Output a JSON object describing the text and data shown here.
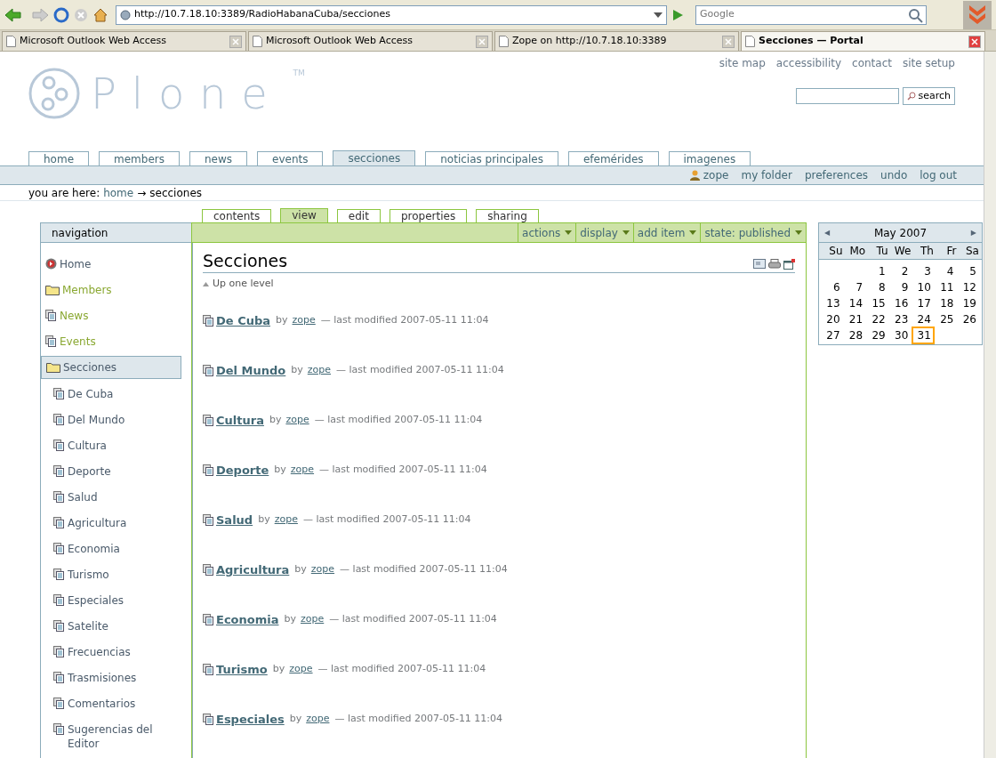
{
  "browser": {
    "url": "http://10.7.18.10:3389/RadioHabanaCuba/secciones",
    "search_placeholder": "Google",
    "tabs": [
      {
        "label": "Microsoft Outlook Web Access",
        "selected": false
      },
      {
        "label": "Microsoft Outlook Web Access",
        "selected": false
      },
      {
        "label": "Zope on http://10.7.18.10:3389",
        "selected": false
      },
      {
        "label": "Secciones — Portal",
        "selected": true
      }
    ]
  },
  "logo": {
    "text": "Plone",
    "mark": "TM"
  },
  "site_actions": [
    "site map",
    "accessibility",
    "contact",
    "site setup"
  ],
  "search": {
    "button": "search"
  },
  "portal_tabs": [
    {
      "label": "home",
      "selected": false
    },
    {
      "label": "members",
      "selected": false
    },
    {
      "label": "news",
      "selected": false
    },
    {
      "label": "events",
      "selected": false
    },
    {
      "label": "secciones",
      "selected": true
    },
    {
      "label": "noticias principales",
      "selected": false
    },
    {
      "label": "efemérides",
      "selected": false
    },
    {
      "label": "imagenes",
      "selected": false
    }
  ],
  "personal_bar": {
    "user": "zope",
    "links": [
      "my folder",
      "preferences",
      "undo",
      "log out"
    ]
  },
  "breadcrumbs": {
    "label": "you are here:",
    "items": [
      {
        "text": "home",
        "link": true
      },
      {
        "text": "secciones",
        "link": false
      }
    ],
    "separator": "→"
  },
  "navigation": {
    "title": "navigation",
    "items": [
      {
        "label": "Home",
        "kind": "home",
        "color": "#4a5a6a",
        "selected": false
      },
      {
        "label": "Members",
        "kind": "folder",
        "color": "#8aa832",
        "selected": false
      },
      {
        "label": "News",
        "kind": "document",
        "color": "#8aa832",
        "selected": false
      },
      {
        "label": "Events",
        "kind": "document",
        "color": "#8aa832",
        "selected": false
      },
      {
        "label": "Secciones",
        "kind": "folder",
        "color": "#4a5a6a",
        "selected": true,
        "children": [
          {
            "label": "De Cuba",
            "kind": "document",
            "color": "#4a5a6a",
            "selected": false
          },
          {
            "label": "Del Mundo",
            "kind": "document",
            "color": "#4a5a6a",
            "selected": false
          },
          {
            "label": "Cultura",
            "kind": "document",
            "color": "#4a5a6a",
            "selected": false
          },
          {
            "label": "Deporte",
            "kind": "document",
            "color": "#4a5a6a",
            "selected": false
          },
          {
            "label": "Salud",
            "kind": "document",
            "color": "#4a5a6a",
            "selected": false
          },
          {
            "label": "Agricultura",
            "kind": "document",
            "color": "#4a5a6a",
            "selected": false
          },
          {
            "label": "Economia",
            "kind": "document",
            "color": "#4a5a6a",
            "selected": false
          },
          {
            "label": "Turismo",
            "kind": "document",
            "color": "#4a5a6a",
            "selected": false
          },
          {
            "label": "Especiales",
            "kind": "document",
            "color": "#4a5a6a",
            "selected": false
          },
          {
            "label": "Satelite",
            "kind": "document",
            "color": "#4a5a6a",
            "selected": false
          },
          {
            "label": "Frecuencias",
            "kind": "document",
            "color": "#4a5a6a",
            "selected": false
          },
          {
            "label": "Trasmisiones",
            "kind": "document",
            "color": "#4a5a6a",
            "selected": false
          },
          {
            "label": "Comentarios",
            "kind": "document",
            "color": "#4a5a6a",
            "selected": false
          },
          {
            "label": "Sugerencias del Editor",
            "kind": "document",
            "color": "#4a5a6a",
            "selected": false
          }
        ]
      }
    ]
  },
  "content_tabs": [
    {
      "label": "contents",
      "selected": false
    },
    {
      "label": "view",
      "selected": true
    },
    {
      "label": "edit",
      "selected": false
    },
    {
      "label": "properties",
      "selected": false
    },
    {
      "label": "sharing",
      "selected": false
    }
  ],
  "content_menus": [
    "actions",
    "display",
    "add item",
    "state: published"
  ],
  "page": {
    "title": "Secciones",
    "up_link": "Up one level",
    "items": [
      {
        "title": "De Cuba",
        "by": "by",
        "author": "zope",
        "modified": "— last modified 2007-05-11 11:04"
      },
      {
        "title": "Del Mundo",
        "by": "by",
        "author": "zope",
        "modified": "— last modified 2007-05-11 11:04"
      },
      {
        "title": "Cultura",
        "by": "by",
        "author": "zope",
        "modified": "— last modified 2007-05-11 11:04"
      },
      {
        "title": "Deporte",
        "by": "by",
        "author": "zope",
        "modified": "— last modified 2007-05-11 11:04"
      },
      {
        "title": "Salud",
        "by": "by",
        "author": "zope",
        "modified": "— last modified 2007-05-11 11:04"
      },
      {
        "title": "Agricultura",
        "by": "by",
        "author": "zope",
        "modified": "— last modified 2007-05-11 11:04"
      },
      {
        "title": "Economia",
        "by": "by",
        "author": "zope",
        "modified": "— last modified 2007-05-11 11:04"
      },
      {
        "title": "Turismo",
        "by": "by",
        "author": "zope",
        "modified": "— last modified 2007-05-11 11:04"
      },
      {
        "title": "Especiales",
        "by": "by",
        "author": "zope",
        "modified": "— last modified 2007-05-11 11:04"
      }
    ]
  },
  "calendar": {
    "month": "May 2007",
    "prev": "◀",
    "next": "▶",
    "weekdays": [
      "Su",
      "Mo",
      "Tu",
      "We",
      "Th",
      "Fr",
      "Sa"
    ],
    "weeks": [
      [
        {
          "day": "1",
          "today": false
        },
        {
          "day": "2",
          "today": false
        },
        {
          "day": "3",
          "today": false
        },
        {
          "day": "4",
          "today": false
        },
        {
          "day": "5",
          "today": false
        }
      ],
      [
        {
          "day": "6",
          "today": false
        },
        {
          "day": "7",
          "today": false
        },
        {
          "day": "8",
          "today": false
        },
        {
          "day": "9",
          "today": false
        },
        {
          "day": "10",
          "today": false
        },
        {
          "day": "11",
          "today": false
        },
        {
          "day": "12",
          "today": false
        }
      ],
      [
        {
          "day": "13",
          "today": false
        },
        {
          "day": "14",
          "today": false
        },
        {
          "day": "15",
          "today": false
        },
        {
          "day": "16",
          "today": false
        },
        {
          "day": "17",
          "today": false
        },
        {
          "day": "18",
          "today": false
        },
        {
          "day": "19",
          "today": false
        }
      ],
      [
        {
          "day": "20",
          "today": false
        },
        {
          "day": "21",
          "today": false
        },
        {
          "day": "22",
          "today": false
        },
        {
          "day": "23",
          "today": false
        },
        {
          "day": "24",
          "today": false
        },
        {
          "day": "25",
          "today": false
        },
        {
          "day": "26",
          "today": false
        }
      ],
      [
        {
          "day": "27",
          "today": false
        },
        {
          "day": "28",
          "today": false
        },
        {
          "day": "29",
          "today": false
        },
        {
          "day": "30",
          "today": false
        },
        {
          "day": "31",
          "today": true
        }
      ]
    ]
  }
}
